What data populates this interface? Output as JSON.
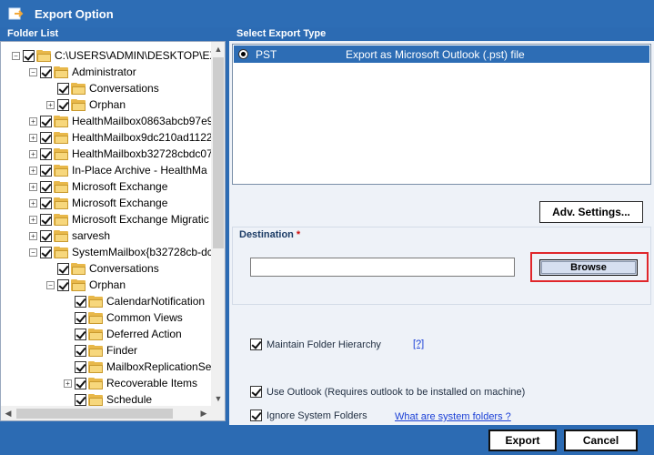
{
  "window": {
    "title": "Export Option"
  },
  "folder_panel": {
    "label": "Folder List"
  },
  "tree": [
    {
      "label": "C:\\USERS\\ADMIN\\DESKTOP\\EX",
      "level": 0,
      "expander": "minus",
      "icon": "hdd"
    },
    {
      "label": "Administrator",
      "level": 1,
      "expander": "minus",
      "icon": "mailbox"
    },
    {
      "label": "Conversations",
      "level": 2,
      "expander": "none",
      "icon": "folder"
    },
    {
      "label": "Orphan",
      "level": 2,
      "expander": "plus",
      "icon": "folder"
    },
    {
      "label": "HealthMailbox0863abcb97e9",
      "level": 1,
      "expander": "plus",
      "icon": "mailbox"
    },
    {
      "label": "HealthMailbox9dc210ad1122",
      "level": 1,
      "expander": "plus",
      "icon": "mailbox"
    },
    {
      "label": "HealthMailboxb32728cbdc07",
      "level": 1,
      "expander": "plus",
      "icon": "mailbox"
    },
    {
      "label": "In-Place Archive - HealthMa",
      "level": 1,
      "expander": "plus",
      "icon": "mailbox"
    },
    {
      "label": "Microsoft Exchange",
      "level": 1,
      "expander": "plus",
      "icon": "mailbox"
    },
    {
      "label": "Microsoft Exchange",
      "level": 1,
      "expander": "plus",
      "icon": "mailbox"
    },
    {
      "label": "Microsoft Exchange Migratic",
      "level": 1,
      "expander": "plus",
      "icon": "mailbox"
    },
    {
      "label": "sarvesh",
      "level": 1,
      "expander": "plus",
      "icon": "mailbox"
    },
    {
      "label": "SystemMailbox{b32728cb-dc",
      "level": 1,
      "expander": "minus",
      "icon": "mailbox"
    },
    {
      "label": "Conversations",
      "level": 2,
      "expander": "none",
      "icon": "folder"
    },
    {
      "label": "Orphan",
      "level": 2,
      "expander": "minus",
      "icon": "folder"
    },
    {
      "label": "CalendarNotification",
      "level": 3,
      "expander": "none",
      "icon": "folder"
    },
    {
      "label": "Common Views",
      "level": 3,
      "expander": "none",
      "icon": "folder"
    },
    {
      "label": "Deferred Action",
      "level": 3,
      "expander": "none",
      "icon": "folder"
    },
    {
      "label": "Finder",
      "level": 3,
      "expander": "none",
      "icon": "folder"
    },
    {
      "label": "MailboxReplicationSe",
      "level": 3,
      "expander": "none",
      "icon": "folder"
    },
    {
      "label": "Recoverable Items",
      "level": 3,
      "expander": "plus",
      "icon": "folder"
    },
    {
      "label": "Schedule",
      "level": 3,
      "expander": "none",
      "icon": "folder"
    }
  ],
  "export_type": {
    "label": "Select Export Type",
    "items": [
      {
        "code": "PST",
        "description": "Export as Microsoft Outlook (.pst) file",
        "selected": true
      }
    ]
  },
  "adv_settings": {
    "label": "Adv. Settings..."
  },
  "destination": {
    "label": "Destination",
    "required_mark": "*",
    "value": "",
    "browse_label": "Browse"
  },
  "options": {
    "maintain_hierarchy": {
      "label": "Maintain Folder Hierarchy",
      "checked": true,
      "help": "[?]"
    },
    "use_outlook": {
      "label": "Use Outlook (Requires outlook to be installed on machine)",
      "checked": true
    },
    "ignore_system": {
      "label": "Ignore System Folders",
      "checked": true,
      "link": "What are system folders ?"
    }
  },
  "footer": {
    "export_label": "Export",
    "cancel_label": "Cancel"
  },
  "colors": {
    "titlebar": "#2d6db5",
    "selection": "#2d6db5",
    "highlight": "#e0262b",
    "link": "#1a3fd6"
  }
}
